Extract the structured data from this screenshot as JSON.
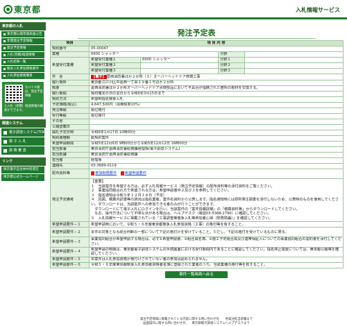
{
  "header": {
    "logo_text": "東京都",
    "site_title": "入札情報サービス"
  },
  "sidebar": {
    "cap1": "東京都の入札",
    "items": [
      "東京都公報等発表画公告",
      "年間発注予定情報",
      "発注予定情報",
      "入札(見積)経過情報",
      "入札結果一覧",
      "競争入札参加資格要件",
      "入札参加資格簡易"
    ],
    "mobile_side": "モバイル版は、発注予定情報",
    "mobile_text": "と入札（見積）経過情報の検索ができます。",
    "cap2": "関連システム",
    "systems": [
      "電子調達システム(TOP)",
      "電 子 入 札",
      "資 格 審 査"
    ],
    "cap3": "リンク",
    "links": [
      "東京電子自治体共同運営",
      "東京都公式ホームページ"
    ]
  },
  "main": {
    "title": "発注予定表",
    "head": [
      "項目",
      "項 目 内 容"
    ],
    "contract_no_label": "契約番号",
    "contract_no": "05-00047",
    "category_label": "業種",
    "category": "6900 シャッター",
    "bunya_label": "分野",
    "bunya": "",
    "desired_label": "希望受付業種",
    "desired": [
      {
        "label": "希望受付業種１",
        "code": "6900 シャッター",
        "sub": "分野１"
      },
      {
        "label": "希望受付業種２",
        "code": "",
        "sub": "分野２"
      },
      {
        "label": "希望受付業種３",
        "code": "",
        "sub": "分野３"
      }
    ],
    "name_label": "件　名",
    "name_tag": "【電子】",
    "name": "葛西消防署ほか２か所（５）オーバーヘッドドア修繕工事",
    "place_label": "履行場所",
    "place": "東京都江戸川区中葛西一丁目２９番１号ほか２か所",
    "summary_label": "概要",
    "summary": "葛西消防署ほか２か所オーバーヘッドドア点検部品において不具合が指摘された箇所の部材を交換する。",
    "period_label": "履行期間",
    "period": "契約確定の日の翌日から令和6年3月15日まで",
    "method_label": "契約方法",
    "method": "希望制指名競争入札",
    "price_label": "予定価格(税込)",
    "price": "4,647,500円（消費税率10%）",
    "issuer_label": "発注等級",
    "issuer": "順位格付",
    "accept_label": "受付等級",
    "accept": "順位格付",
    "jv_label": "その他",
    "jv": "",
    "publicity_label": "公報登載日",
    "publicity": "",
    "date_label": "開札予定日時",
    "date": "令和6年1月17日 10時00分",
    "doc_label": "契約書種類",
    "doc": "紙契約案件",
    "apply_label": "希望申請期間",
    "apply": "令和5年12月6日 9時00分から令和5年12月12日 16時00分",
    "dept_label": "担当部署",
    "dept": "東京消防庁葛西消防署総務課経理係(電子調達システム)",
    "section_label": "担当部課",
    "section": "東京消防庁葛西消防署総務課",
    "person_label": "担当者",
    "person": "経理係",
    "phone_label": "連絡先",
    "phone": "03-3689-0119",
    "files_label": "配布資料等",
    "files": [
      "参加制限要件",
      "希望申請要件"
    ],
    "conditions_label": "発注予定備考",
    "conditions": [
      "【重要】",
      "１　当該案件を希望する方は、必ず入札情報サービス（発注予定情報）の配布資料等の添付資料をご覧ください。",
      "２　事業協同組合の方で希望される方は、希望申請書中２及び３を参照してください。",
      "３　指名通知は令和５年１２月１８日（予定）",
      "４　回図、積算内訳書等の貸出は指名業者。案件名資料から公表します。指名通知時には原則発注図書を添付しないため、公表時のものを使用してください。ダウンロードは、当該案件への参加できる者のみが行うことができます。",
      "　ダウンロードにて電子入札にログインを行い、当該案件の「案件情報詳細」の「積算資料等」からダウンロードしてください。",
      "　なお、操作方法について不明な点がある場合は、ヘルプデスク（電話03-5388-2790）に確認してください。",
      "５　入札情報サービスに掲載されている「工事調査等競争入札等参加者心得（財務局編）」を確認してください。"
    ],
    "req1_label": "希望申請要件－１",
    "req1": "希望申請時において、令和５・６年度東京都競争入札参加資格（工事）の格付等を有すること。",
    "req2_label": "希望申請要件－２",
    "req2": "本件の対象となる総合判断の一部について下記の格付けを受けていること。ただし、下記の格付を受けているものに限る。",
    "req3_label": "希望申請要件－３",
    "req3": "事業協同組合が希望申請する場合は、必ず①希望申請書、②組合員名簿、③施工予定組合員及び連帯保証人についての事業協同組合の誓約書を添付してください。",
    "req4_label": "希望申請要件－４",
    "req4": "希望申請の時期は、東京都電子調達システムの手続画面における受付期間内であることに確認してください。指名停止措置については、東京都公報等を確認してください。",
    "req5_label": "希望申請要件－５",
    "req5": "本案件は入札参加資格が格付けされていない者の参加は認められません。",
    "req6_label": "希望申請要件－６",
    "req6": "令和５・６年度東京都競争入札参加者資格者名簿に登録された業者のうち、当該業種の格付等を有すること。",
    "back_button": "案件一覧画面へ戻る"
  },
  "footer": {
    "line1": "発注予定情報に掲載されている内容に関する問い合わせ先　　各発注担当部署まで",
    "line2": "画面操作に関する問い合わせ先　　東京都電子調達システムヘルプデスクまで"
  }
}
